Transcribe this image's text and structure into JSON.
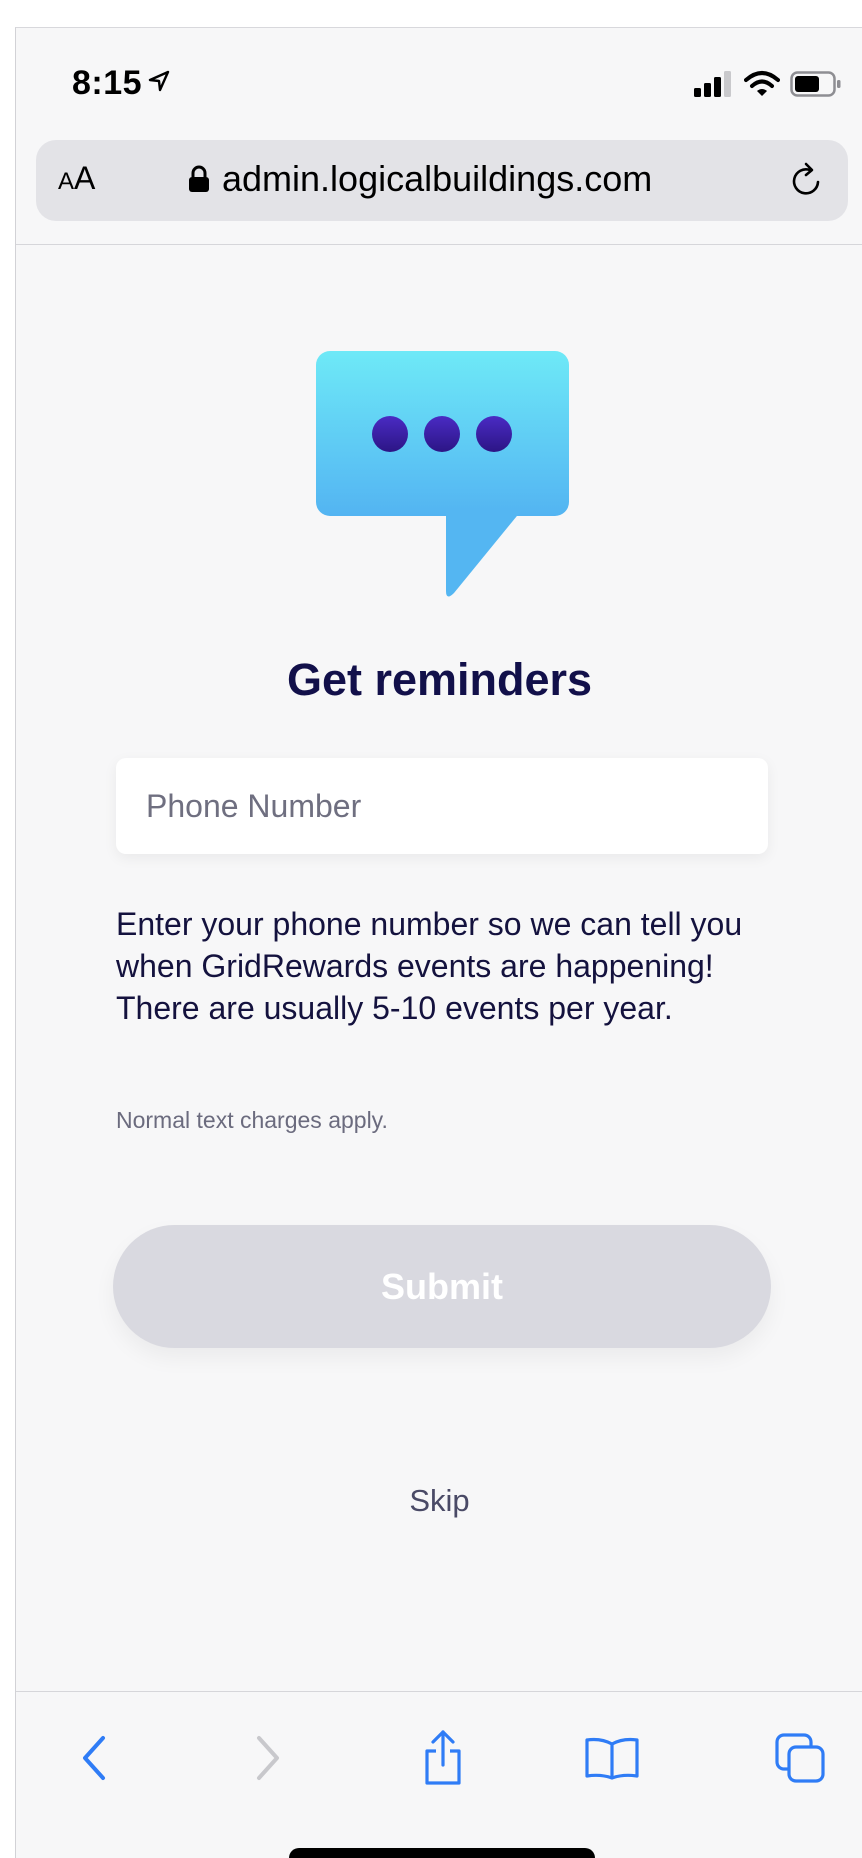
{
  "status_bar": {
    "time": "8:15"
  },
  "browser": {
    "text_size_label_small": "A",
    "text_size_label_large": "A",
    "url": "admin.logicalbuildings.com"
  },
  "page": {
    "title": "Get reminders",
    "phone": {
      "placeholder": "Phone Number",
      "value": ""
    },
    "description": "Enter your phone number so we can tell you when GridRewards events are happening! There are usually 5-10 events per year.",
    "fine_print": "Normal text charges apply.",
    "submit_label": "Submit",
    "skip_label": "Skip"
  },
  "colors": {
    "heading": "#12104a",
    "submit_disabled_bg": "#d9d9e0",
    "bubble_top": "#6ee9f7",
    "bubble_bottom": "#53b4f2",
    "dots": "#3b1fa6",
    "toolbar_active": "#2f7cf6",
    "toolbar_disabled": "#c8c8cc"
  },
  "icons": [
    "location-arrow-icon",
    "cellular-signal-icon",
    "wifi-icon",
    "battery-icon",
    "lock-icon",
    "reload-icon",
    "chat-bubble-icon",
    "back-icon",
    "forward-icon",
    "share-icon",
    "bookmarks-icon",
    "tabs-icon"
  ]
}
